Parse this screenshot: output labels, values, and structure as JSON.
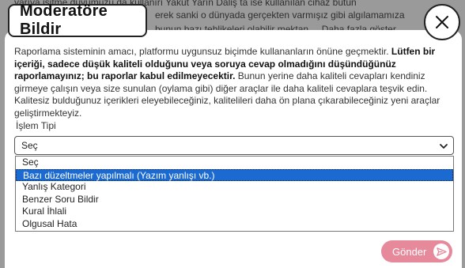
{
  "background": {
    "line1": "yarıya işitme duyumuzu da kullanırı Yakut Yarın Daliş ta ise kullanılan cihaz bütün",
    "line2": "erek sanki o dünyada gerçekten varmışız gibi algılamamıza",
    "line3": "bunun bazı tehlikeleri olabilir mektan ... Daha fazla göster"
  },
  "modal": {
    "title": "Moderatöre Bildir",
    "close_label": "×",
    "description_1": "Raporlama sisteminin amacı, platformu uygunsuz biçimde kullananların önüne geçmektir. ",
    "description_bold": "Lütfen bir içeriği, sadece düşük kaliteli olduğunu veya soruya cevap olmadığını düşündüğünüz raporlamayınız; bu raporlar kabul edilmeyecektir.",
    "description_2": " Bunun yerine daha kaliteli cevapları kendiniz girmeye çalışın veya size sunulan (oylama gibi) diğer araçlar ile daha kaliteli cevaplara teşvik edin. Kalitesiz bulduğunuz içerikleri eleyebileceğiniz, kalitelileri daha ön plana çıkarabileceğiniz yeni araçlar geliştirmekteyiz.",
    "field_label": "İşlem Tipi",
    "select_value": "Seç",
    "options": [
      "Seç",
      "Bazı düzeltmeler yapılmalı (Yazım yanlışı vb.)",
      "Yanlış Kategori",
      "Benzer Soru Bildir",
      "Kural İhlali",
      "Olgusal Hata"
    ],
    "selected_index": 1,
    "send_label": "Gönder"
  },
  "colors": {
    "accent": "#e6899b",
    "selection": "#1a6ad2"
  }
}
